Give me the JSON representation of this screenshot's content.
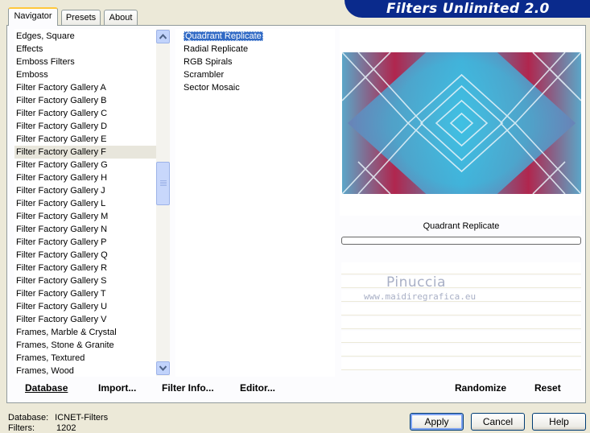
{
  "banner": {
    "title": "Filters Unlimited 2.0"
  },
  "tabs": [
    {
      "label": "Navigator",
      "active": true
    },
    {
      "label": "Presets",
      "active": false
    },
    {
      "label": "About",
      "active": false
    }
  ],
  "categories": [
    "Edges, Square",
    "Effects",
    "Emboss Filters",
    "Emboss",
    "Filter Factory Gallery A",
    "Filter Factory Gallery B",
    "Filter Factory Gallery C",
    "Filter Factory Gallery D",
    "Filter Factory Gallery E",
    "Filter Factory Gallery F",
    "Filter Factory Gallery G",
    "Filter Factory Gallery H",
    "Filter Factory Gallery J",
    "Filter Factory Gallery L",
    "Filter Factory Gallery M",
    "Filter Factory Gallery N",
    "Filter Factory Gallery P",
    "Filter Factory Gallery Q",
    "Filter Factory Gallery R",
    "Filter Factory Gallery S",
    "Filter Factory Gallery T",
    "Filter Factory Gallery U",
    "Filter Factory Gallery V",
    "Frames, Marble & Crystal",
    "Frames, Stone & Granite",
    "Frames, Textured",
    "Frames, Wood"
  ],
  "highlighted_category": "Filter Factory Gallery F",
  "filters": [
    "Quadrant Replicate",
    "Radial Replicate",
    "RGB Spirals",
    "Scrambler",
    "Sector Mosaic"
  ],
  "selected_filter": "Quadrant Replicate",
  "preview": {
    "caption": "Quadrant Replicate"
  },
  "watermark": {
    "name": "Pinuccia",
    "url": "www.maidiregrafica.eu"
  },
  "toolbar": {
    "database": "Database",
    "import": "Import...",
    "filter_info": "Filter Info...",
    "editor": "Editor...",
    "randomize": "Randomize",
    "reset": "Reset"
  },
  "buttons": {
    "apply": "Apply",
    "cancel": "Cancel",
    "help": "Help"
  },
  "status": {
    "database_label": "Database:",
    "database_value": "ICNET-Filters",
    "filters_label": "Filters:",
    "filters_value": "1202"
  },
  "colors": {
    "banner": "#0A2A8C",
    "selection": "#316AC5",
    "preview_pink": "#B0264E",
    "preview_cyan": "#3EC6E8"
  }
}
